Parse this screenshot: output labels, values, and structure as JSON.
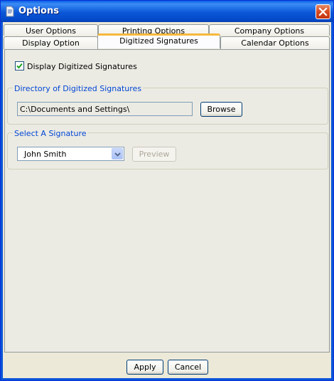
{
  "window": {
    "title": "Options",
    "close_icon": "close-icon",
    "app_icon": "document-icon"
  },
  "tabs": {
    "row1": [
      {
        "label": "User Options"
      },
      {
        "label": "Printing Options"
      },
      {
        "label": "Company Options"
      }
    ],
    "row2": [
      {
        "label": "Display Option"
      },
      {
        "label": "Digitized Signatures",
        "active": true
      },
      {
        "label": "Calendar Options"
      }
    ]
  },
  "display": {
    "checkbox_label": "Display Digitized Signatures",
    "checked": true
  },
  "directory": {
    "group_title": "Directory of Digitized Signatures",
    "value": "C:\\Documents and Settings\\",
    "browse_label": "Browse"
  },
  "signature": {
    "group_title": "Select A Signature",
    "selected": "John Smith",
    "preview_label": "Preview"
  },
  "footer": {
    "apply_label": "Apply",
    "cancel_label": "Cancel"
  },
  "colors": {
    "title_bar": "#0a5fe4",
    "group_title": "#0046d5",
    "active_tab_accent": "#f6b83c",
    "close_button": "#d8491f"
  }
}
